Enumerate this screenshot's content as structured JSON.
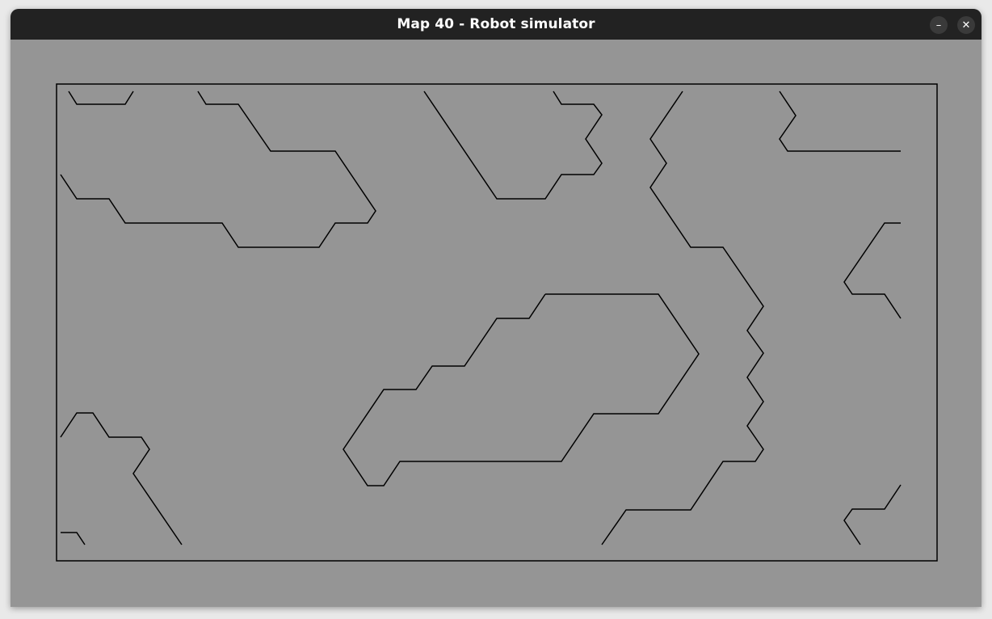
{
  "window": {
    "title": "Map 40 - Robot simulator",
    "minimize_glyph": "–",
    "close_glyph": "✕"
  },
  "icons": {
    "minimize": "minimize-icon",
    "close": "close-icon"
  },
  "colors": {
    "titlebar": "#222222",
    "map_background": "#959595",
    "obstacle_stroke": "#000000"
  }
}
